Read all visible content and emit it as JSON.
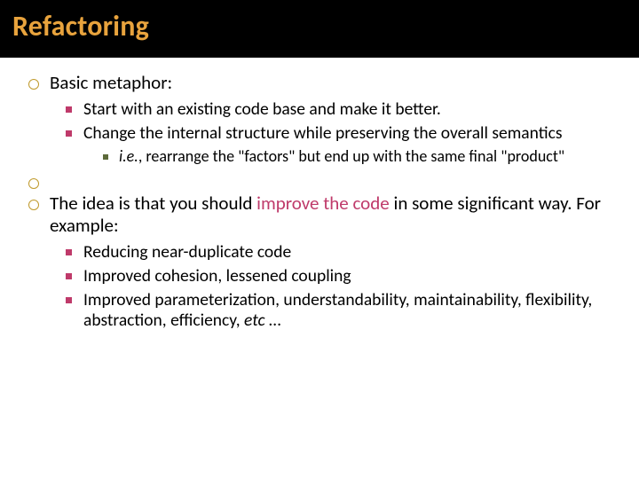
{
  "title": "Refactoring",
  "b1": {
    "heading": "Basic metaphor:",
    "s1": "Start with an existing code base and make it better.",
    "s2": "Change the internal structure while preserving the overall semantics",
    "sub1_prefix": "i.e.",
    "sub1_rest": ", rearrange the \"factors\" but end up with the same final \"product\""
  },
  "b2": {
    "h_pre": "The idea is that you should ",
    "h_em": "improve the code",
    "h_post": " in some significant way. For example:",
    "s1": "Reducing near-duplicate code",
    "s2": "Improved cohesion, lessened coupling",
    "s3_pre": "Improved parameterization, understandability, maintainability, flexibility, abstraction, efficiency, ",
    "s3_em": "etc",
    "s3_post": " …"
  }
}
